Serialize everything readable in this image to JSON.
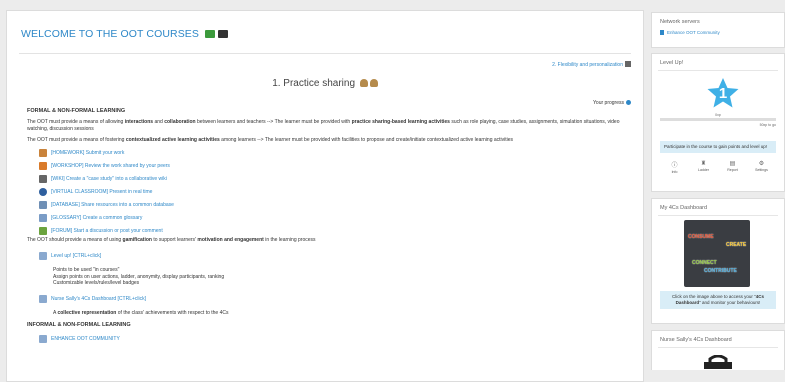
{
  "course": {
    "title": "WELCOME TO THE OOT COURSES",
    "next_link": "2. Flexibility and personalization"
  },
  "section": {
    "title": "1. Practice sharing",
    "progress_label": "Your progress"
  },
  "content": {
    "heading1": "FORMAL & NON-FORMAL LEARNING",
    "para1_parts": [
      "The OOT must provide a means of allowing ",
      "interactions",
      " and ",
      "collaboration",
      " between learners and teachers --> The learner must be provided with ",
      "practice sharing-based learning activities",
      " such as role playing, case studies, assignments, simulation situations, video watching, discussion sessions"
    ],
    "para2_parts": [
      "The OOT must provide a means of fostering ",
      "contextualized active learning activities",
      " among learners --> The learner must be provided with facilities to propose and create/initiate contextualized active learning activities"
    ],
    "activities": [
      {
        "label": "[HOMEWORK] Submit your work",
        "color": "#c9833b"
      },
      {
        "label": "[WORKSHOP] Review the work shared by your peers",
        "color": "#d97a2a"
      },
      {
        "label": "[WIKI] Create a \"case study\" into a collaborative wiki",
        "color": "#666666"
      },
      {
        "label": "[VIRTUAL CLASSROOM] Present in real time",
        "color": "#2e5f9e"
      },
      {
        "label": "[DATABASE] Share resources into a common database",
        "color": "#6f8fb5"
      },
      {
        "label": "[GLOSSARY] Create a common glossary",
        "color": "#7a9cc6"
      },
      {
        "label": "[FORUM] Start a discussion or post your comment",
        "color": "#6ba33e"
      }
    ],
    "para3_parts": [
      "The OOT should provide a means of using ",
      "gamification",
      " to support learners' ",
      "motivation and engagement",
      " in the learning process"
    ],
    "levelup_link": "Level up! [CTRL+click]",
    "levelup_sub": [
      "Points to be used \"in courses\"",
      "Assign points on user actions, ladder, anonymity, display participants, ranking",
      "Customizable levels/rules/level badges"
    ],
    "dashboard_link": "Nurse Sally's 4Cs Dashboard [CTRL+click]",
    "collective_parts": [
      "A ",
      "collective representation",
      " of the class' achievements with respect to the 4Cs"
    ],
    "heading2": "INFORMAL & NON-FORMAL LEARNING",
    "enhance_link": "ENHANCE OOT COMMUNITY"
  },
  "sidebar": {
    "network": {
      "title": "Network servers",
      "link": "Enhance OOT Community"
    },
    "levelup": {
      "title": "Level Up!",
      "level": "1",
      "xp": "0xp",
      "to_next": "50xp to go",
      "progress": 0,
      "info": "Participate in the course to gain points and level up!",
      "icons": [
        {
          "label": "Info",
          "glyph": "ⓘ"
        },
        {
          "label": "Ladder",
          "glyph": "♜"
        },
        {
          "label": "Report",
          "glyph": "▤"
        },
        {
          "label": "Settings",
          "glyph": "⚙"
        }
      ]
    },
    "dashboard": {
      "title": "My 4Cs Dashboard",
      "words": [
        "CONSUME",
        "CREATE",
        "CONNECT",
        "CONTRIBUTE"
      ],
      "info_parts": [
        "Click on the image above to access your \"",
        "4Cs Dashboard",
        "\" and monitor your behaviours!"
      ]
    },
    "sally": {
      "title": "Nurse Sally's 4Cs Dashboard"
    }
  },
  "colors": {
    "link": "#2e88c8",
    "star": "#3fb0e6",
    "info_bg": "#d9edf7",
    "board_bg": "#3a3d42",
    "consume": "#e04a2b",
    "create": "#f2c230",
    "connect": "#8fc43d",
    "contribute": "#48a8d8"
  }
}
